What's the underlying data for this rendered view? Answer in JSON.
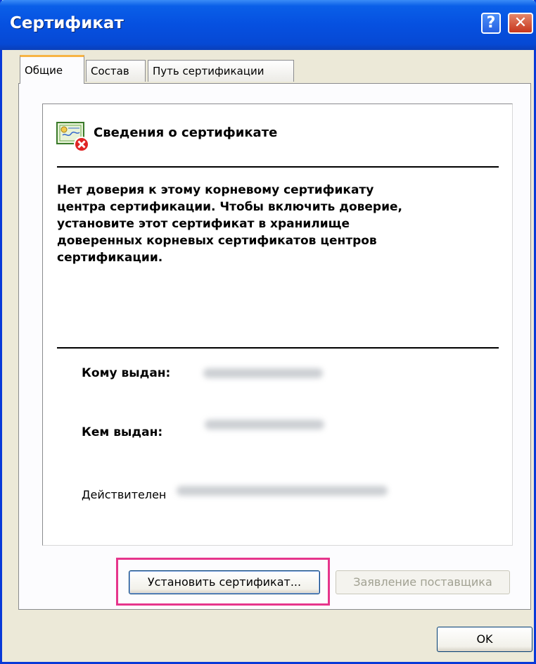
{
  "window": {
    "title": "Сертификат",
    "help_label": "?",
    "close_label": "✕"
  },
  "tabs": [
    {
      "label": "Общие"
    },
    {
      "label": "Состав"
    },
    {
      "label": "Путь сертификации"
    }
  ],
  "info": {
    "icon": "certificate-error-icon",
    "title": "Сведения о сертификате",
    "message_lines": [
      "Нет доверия к этому корневому сертификату",
      "центра сертификации. Чтобы включить  доверие,",
      "установите этот сертификат в хранилище",
      "доверенных корневых сертификатов центров",
      "сертификации."
    ],
    "issued_to_label": "Кому выдан:",
    "issued_by_label": "Кем выдан:",
    "valid_label": "Действителен"
  },
  "buttons": {
    "install": "Установить сертификат...",
    "vendor_statement": "Заявление поставщика",
    "ok": "OK"
  },
  "colors": {
    "titlebar": "#0650e0",
    "highlight": "#e6358c",
    "tab_accent": "#f7b445"
  }
}
